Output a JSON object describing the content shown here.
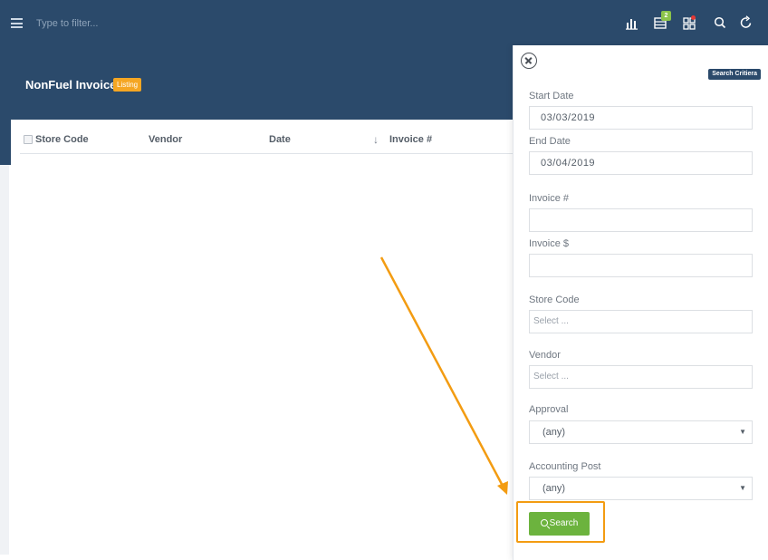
{
  "topbar": {
    "filter_placeholder": "Type to filter...",
    "icons": [
      "bar-chart-icon",
      "list-icon",
      "grid-icon",
      "search-icon",
      "refresh-icon"
    ],
    "notification_count": "2"
  },
  "header": {
    "title": "NonFuel Invoice",
    "tag": "Listing"
  },
  "table": {
    "columns": [
      "Store Code",
      "Vendor",
      "Date",
      "Invoice #"
    ]
  },
  "panel": {
    "tag": "Search Critiera",
    "start_date_label": "Start Date",
    "start_date_value": "03/03/2019",
    "end_date_label": "End Date",
    "end_date_value": "03/04/2019",
    "invoice_num_label": "Invoice #",
    "invoice_amt_label": "Invoice $",
    "store_code_label": "Store Code",
    "store_code_placeholder": "Select ...",
    "vendor_label": "Vendor",
    "vendor_placeholder": "Select ...",
    "approval_label": "Approval",
    "approval_value": "(any)",
    "accounting_label": "Accounting Post",
    "accounting_value": "(any)",
    "search_label": "Search"
  },
  "colors": {
    "header_bg": "#2b4a6b",
    "tag_orange": "#f5a623",
    "search_green": "#6cb33e",
    "annotation_orange": "#f39c12",
    "badge_green": "#8bc34a"
  }
}
